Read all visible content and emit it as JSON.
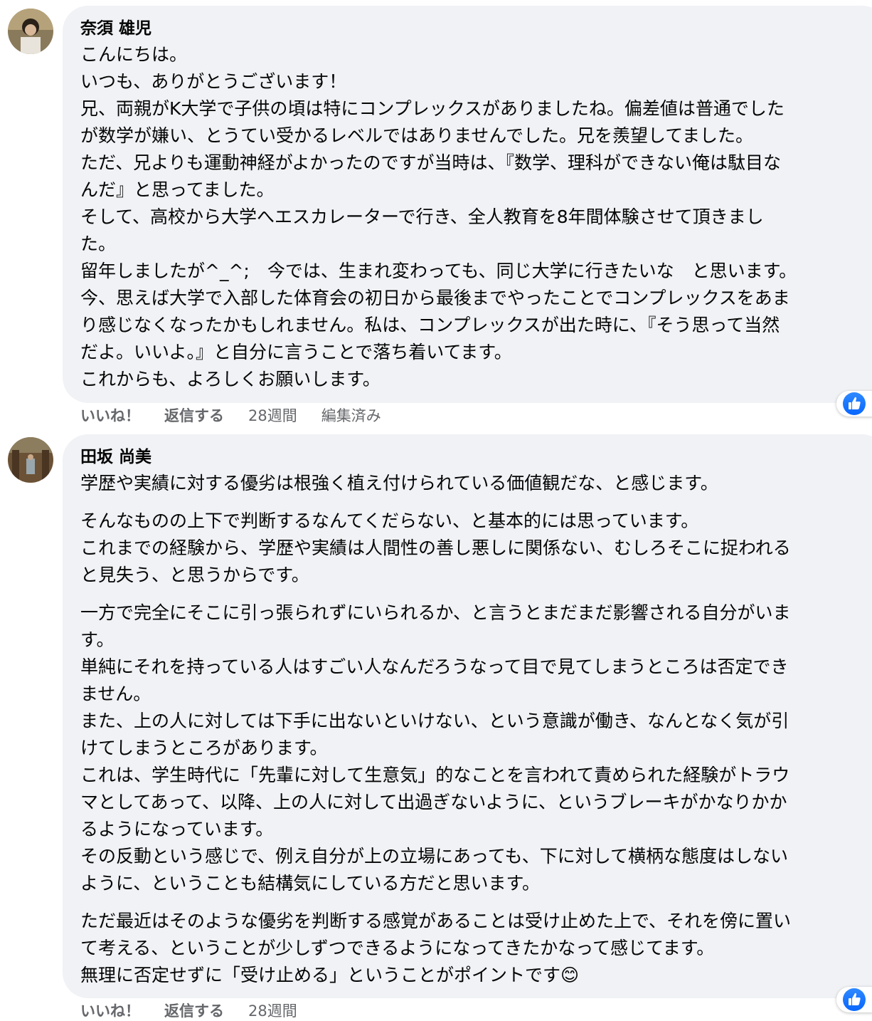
{
  "comments": [
    {
      "author": "奈須 雄児",
      "lines": [
        "こんにちは。",
        "いつも、ありがとうございます！",
        "兄、両親がK大学で子供の頃は特にコンプレックスがありましたね。偏差値は普通でした",
        "が数学が嫌い、とうてい受かるレベルではありませんでした。兄を羨望してました。",
        "ただ、兄よりも運動神経がよかったのですが当時は、『数学、理科ができない俺は駄目な",
        "んだ』と思ってました。",
        "そして、高校から大学へエスカレーターで行き、全人教育を8年間体験させて頂きまし",
        "た。",
        "留年しましたが^_^;　今では、生まれ変わっても、同じ大学に行きたいな　と思います。",
        "今、思えば大学で入部した体育会の初日から最後までやったことでコンプレックスをあま",
        "り感じなくなったかもしれません。私は、コンプレックスが出た時に、『そう思って当然",
        "だよ。いいよ。』と自分に言うことで落ち着いてます。",
        "これからも、よろしくお願いします。"
      ],
      "actions": {
        "like": "いいね！",
        "reply": "返信する",
        "time": "28週間",
        "edited": "編集済み"
      }
    },
    {
      "author": "田坂 尚美",
      "para1": [
        "学歴や実績に対する優劣は根強く植え付けられている価値観だな、と感じます。"
      ],
      "para2": [
        "そんなものの上下で判断するなんてくだらない、と基本的には思っています。",
        "これまでの経験から、学歴や実績は人間性の善し悪しに関係ない、むしろそこに捉われる",
        "と見失う、と思うからです。"
      ],
      "para3": [
        "一方で完全にそこに引っ張られずにいられるか、と言うとまだまだ影響される自分がいま",
        "す。",
        "単純にそれを持っている人はすごい人なんだろうなって目で見てしまうところは否定でき",
        "ません。",
        "また、上の人に対しては下手に出ないといけない、という意識が働き、なんとなく気が引",
        "けてしまうところがあります。",
        "これは、学生時代に「先輩に対して生意気」的なことを言われて責められた経験がトラウ",
        "マとしてあって、以降、上の人に対して出過ぎないように、というブレーキがかなりかか",
        "るようになっています。",
        "その反動という感じで、例え自分が上の立場にあっても、下に対して横柄な態度はしない",
        "ように、ということも結構気にしている方だと思います。"
      ],
      "para4": [
        "ただ最近はそのような優劣を判断する感覚があることは受け止めた上で、それを傍に置い",
        "て考える、ということが少しずつできるようになってきたかなって感じてます。",
        "無理に否定せずに「受け止める」ということがポイントです"
      ],
      "emoji": "😊",
      "actions": {
        "like": "いいね！",
        "reply": "返信する",
        "time": "28週間"
      }
    }
  ],
  "colors": {
    "bubble": "#f0f2f5",
    "meta": "#65676b",
    "like_blue": "#0866ff"
  }
}
